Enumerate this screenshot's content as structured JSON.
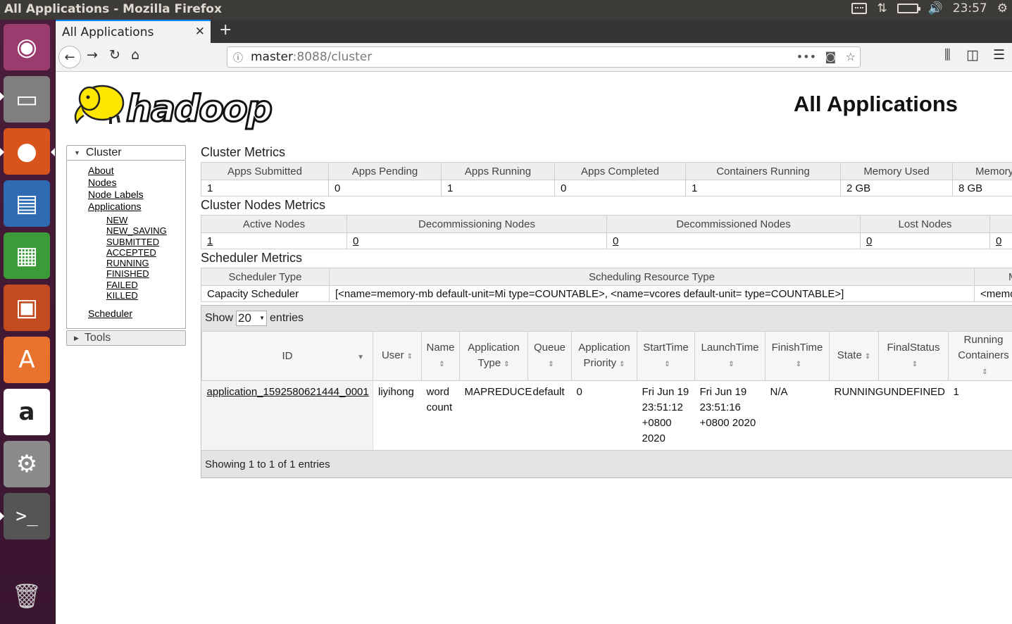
{
  "window": {
    "title": "All Applications - Mozilla Firefox",
    "clock": "23:57"
  },
  "launcher": {
    "items": [
      {
        "name": "ubuntu-dash",
        "glyph": "◉"
      },
      {
        "name": "files",
        "glyph": "▭"
      },
      {
        "name": "firefox",
        "glyph": "●"
      },
      {
        "name": "writer",
        "glyph": "▤"
      },
      {
        "name": "calc",
        "glyph": "▦"
      },
      {
        "name": "impress",
        "glyph": "▣"
      },
      {
        "name": "software-center",
        "glyph": "A"
      },
      {
        "name": "amazon",
        "glyph": "a"
      },
      {
        "name": "system-settings",
        "glyph": "⚙"
      },
      {
        "name": "terminal",
        "glyph": ">_"
      },
      {
        "name": "trash",
        "glyph": "🗑"
      }
    ]
  },
  "browser": {
    "tab_label": "All Applications",
    "url_host": "master",
    "url_path": ":8088/cluster"
  },
  "page": {
    "title": "All Applications",
    "logo_text": "hadoop"
  },
  "nav": {
    "cluster_label": "Cluster",
    "tools_label": "Tools",
    "links": {
      "about": "About",
      "nodes": "Nodes",
      "node_labels": "Node Labels",
      "applications": "Applications",
      "scheduler": "Scheduler"
    },
    "app_states": [
      "NEW",
      "NEW_SAVING",
      "SUBMITTED",
      "ACCEPTED",
      "RUNNING",
      "FINISHED",
      "FAILED",
      "KILLED"
    ]
  },
  "cluster_metrics": {
    "title": "Cluster Metrics",
    "headers": [
      "Apps Submitted",
      "Apps Pending",
      "Apps Running",
      "Apps Completed",
      "Containers Running",
      "Memory Used",
      "Memory"
    ],
    "values": [
      "1",
      "0",
      "1",
      "0",
      "1",
      "2 GB",
      "8 GB"
    ]
  },
  "nodes_metrics": {
    "title": "Cluster Nodes Metrics",
    "headers": [
      "Active Nodes",
      "Decommissioning Nodes",
      "Decommissioned Nodes",
      "Lost Nodes",
      ""
    ],
    "values": [
      "1",
      "0",
      "0",
      "0",
      "0"
    ]
  },
  "scheduler_metrics": {
    "title": "Scheduler Metrics",
    "headers": [
      "Scheduler Type",
      "Scheduling Resource Type",
      "M"
    ],
    "values": [
      "Capacity Scheduler",
      "[<name=memory-mb default-unit=Mi type=COUNTABLE>, <name=vcores default-unit= type=COUNTABLE>]",
      "<memo"
    ]
  },
  "apps_table": {
    "show_label": "Show",
    "show_value": "20",
    "entries_label": "entries",
    "headers": [
      "ID",
      "User",
      "Name",
      "Application Type",
      "Queue",
      "Application Priority",
      "StartTime",
      "LaunchTime",
      "FinishTime",
      "State",
      "FinalStatus",
      "Running Containers"
    ],
    "rows": [
      [
        "application_1592580621444_0001",
        "liyihong",
        "word count",
        "MAPREDUCE",
        "default",
        "0",
        "Fri Jun 19 23:51:12 +0800 2020",
        "Fri Jun 19 23:51:16 +0800 2020",
        "N/A",
        "RUNNING",
        "UNDEFINED",
        "1"
      ]
    ],
    "footer": "Showing 1 to 1 of 1 entries"
  },
  "colors": {
    "topbar": "#3c3b37",
    "launcher": "#4a1d3a",
    "firefox_accent": "#0a84ff",
    "hadoop_yellow": "#ffe600"
  }
}
